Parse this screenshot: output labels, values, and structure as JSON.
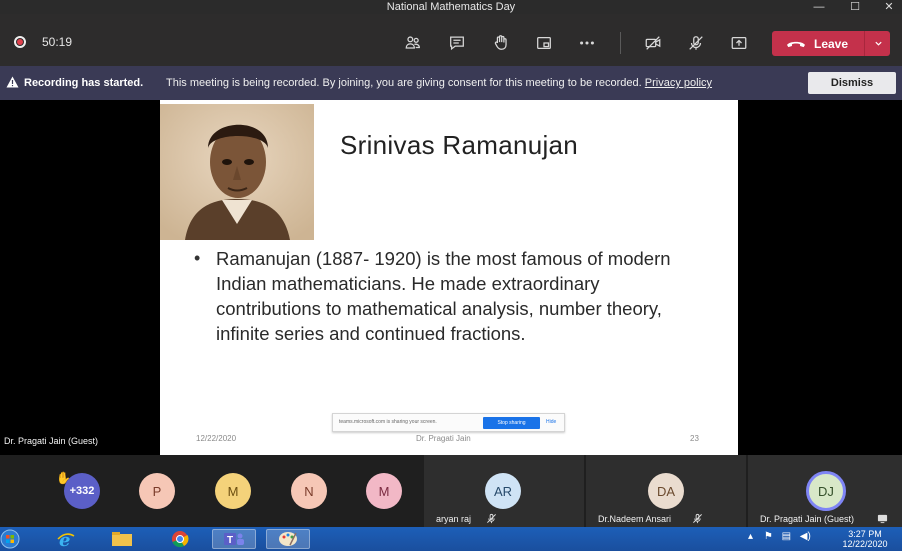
{
  "window": {
    "title": "National Mathematics Day",
    "min_glyph": "—",
    "max_glyph": "☐",
    "close_glyph": "✕"
  },
  "toolbar": {
    "timer": "50:19",
    "leave_label": "Leave",
    "leave_color": "#c4314b"
  },
  "banner": {
    "title": "Recording has started.",
    "text": "This meeting is being recorded. By joining, you are giving consent for this meeting to be recorded.",
    "link": "Privacy policy",
    "dismiss_label": "Dismiss",
    "background": "#3a3a55"
  },
  "stage": {
    "presenter_label": "Dr. Pragati Jain (Guest)"
  },
  "slide": {
    "title": "Srinivas Ramanujan",
    "bullet": "Ramanujan (1887- 1920) is the most famous of modern Indian mathematicians. He made extraordinary contributions to mathematical analysis, number theory, infinite series and continued fractions.",
    "date": "12/22/2020",
    "author": "Dr. Pragati Jain",
    "page_number": "23"
  },
  "share_notice": {
    "text": "teams.microsoft.com is sharing your screen.",
    "stop_label": "Stop sharing",
    "hide_label": "Hide"
  },
  "participants": {
    "overflow": {
      "label": "+332",
      "color": "#5b5fc7"
    },
    "bubbles": [
      {
        "initial": "P",
        "color": "#f6c7b6"
      },
      {
        "initial": "M",
        "color": "#f4d27a"
      },
      {
        "initial": "N",
        "color": "#f6c7b6"
      },
      {
        "initial": "M",
        "color": "#f2b8c6"
      }
    ],
    "tiles": [
      {
        "initials": "AR",
        "name": "aryan raj",
        "color": "#cfe3f5"
      },
      {
        "initials": "DA",
        "name": "Dr.Nadeem Ansari",
        "color": "#eadccf"
      },
      {
        "initials": "DJ",
        "name": "Dr. Pragati Jain (Guest)",
        "color": "#d8e8c8"
      }
    ]
  },
  "taskbar": {
    "time": "3:27 PM",
    "date": "12/22/2020"
  }
}
